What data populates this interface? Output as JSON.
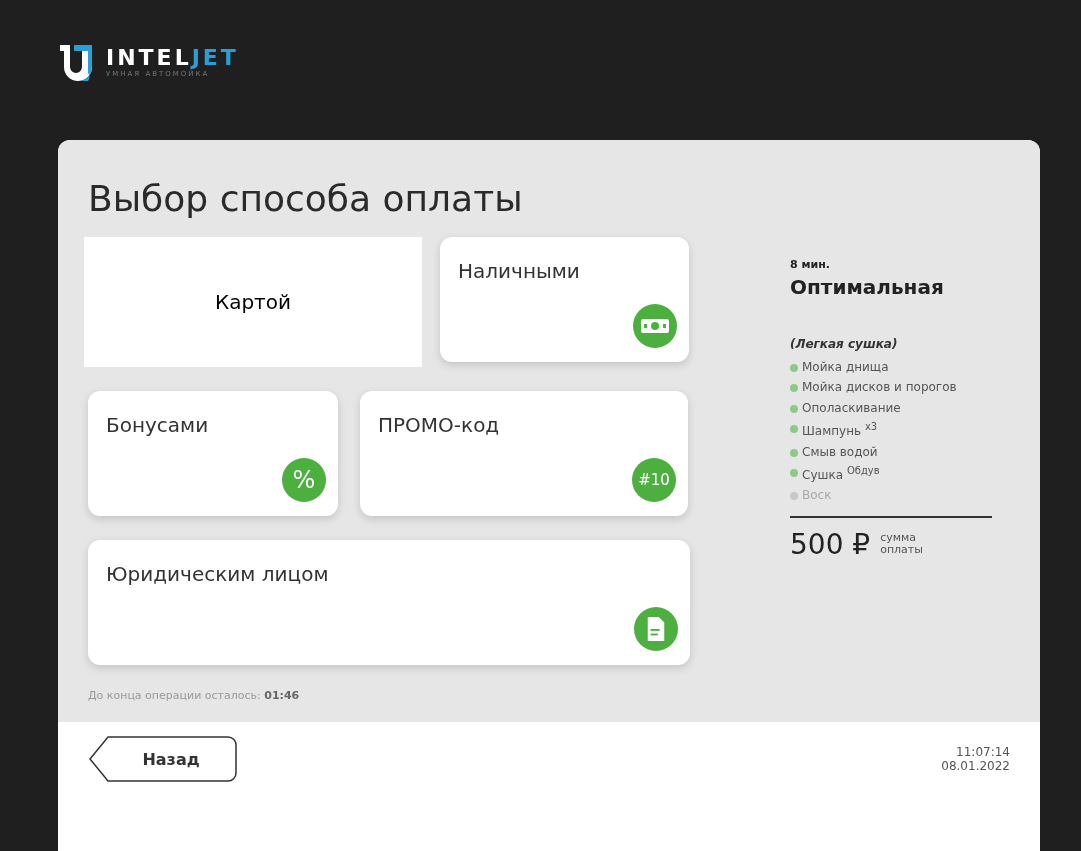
{
  "logo": {
    "name_a": "INTEL",
    "name_b": "JET",
    "tagline": "УМНАЯ АВТОМОЙКА"
  },
  "title": "Выбор способа оплаты",
  "methods": [
    [
      {
        "label": "Картой",
        "kind": "plain"
      },
      {
        "label": "Наличными",
        "kind": "cash"
      }
    ],
    [
      {
        "label": "Бонусами",
        "kind": "glyph",
        "glyph": "%"
      },
      {
        "label": "ПРОМО-код",
        "kind": "ticket",
        "glyph": "#10"
      }
    ],
    [
      {
        "label": "Юридическим лицом",
        "kind": "document"
      }
    ]
  ],
  "timer": {
    "label": "До конца операции осталось:",
    "value": "01:46"
  },
  "program": {
    "duration": "8 мин.",
    "name": "Оптимальная",
    "note": "(Легкая сушка)",
    "services": [
      {
        "label": "Мойка днища",
        "included": true
      },
      {
        "label": "Мойка дисков и порогов",
        "included": true
      },
      {
        "label": "Ополаскивание",
        "included": true
      },
      {
        "label": "Шампунь $^{x3}$",
        "included": true
      },
      {
        "label": "Смыв водой",
        "included": true
      },
      {
        "label": "Сушка $^{Обдув}$",
        "included": true
      },
      {
        "label": "Воск",
        "included": false
      }
    ],
    "price": "500 ₽",
    "price_label": "сумма оплаты"
  },
  "back_button": "Назад",
  "clock": {
    "time": "11:07:14",
    "date": "08.01.2022"
  }
}
